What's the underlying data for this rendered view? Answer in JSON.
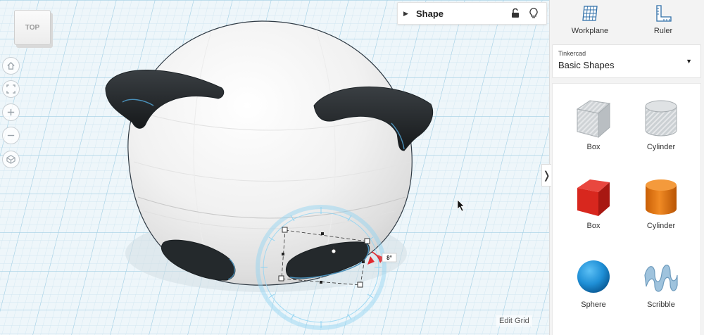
{
  "viewcube": {
    "label": "TOP"
  },
  "shape_panel": {
    "title": "Shape"
  },
  "workspace": {
    "edit_grid_label": "Edit Grid",
    "rotation_angle_label": "8°"
  },
  "sidebar": {
    "tools": [
      {
        "label": "Workplane",
        "icon": "workplane-icon"
      },
      {
        "label": "Ruler",
        "icon": "ruler-icon"
      }
    ],
    "library": {
      "provider": "Tinkercad",
      "selected": "Basic Shapes"
    },
    "shapes": [
      {
        "label": "Box",
        "icon": "box-striped-icon"
      },
      {
        "label": "Cylinder",
        "icon": "cylinder-striped-icon"
      },
      {
        "label": "Box",
        "icon": "box-red-icon"
      },
      {
        "label": "Cylinder",
        "icon": "cylinder-orange-icon"
      },
      {
        "label": "Sphere",
        "icon": "sphere-blue-icon"
      },
      {
        "label": "Scribble",
        "icon": "scribble-icon"
      }
    ]
  },
  "colors": {
    "grid_background": "#eef6fa",
    "box_red": "#d8271e",
    "cylinder_orange": "#e8750f",
    "sphere_blue": "#1f8fd6",
    "selection_cyan": "#8fd3f2",
    "rotation_red": "#e0282e"
  }
}
